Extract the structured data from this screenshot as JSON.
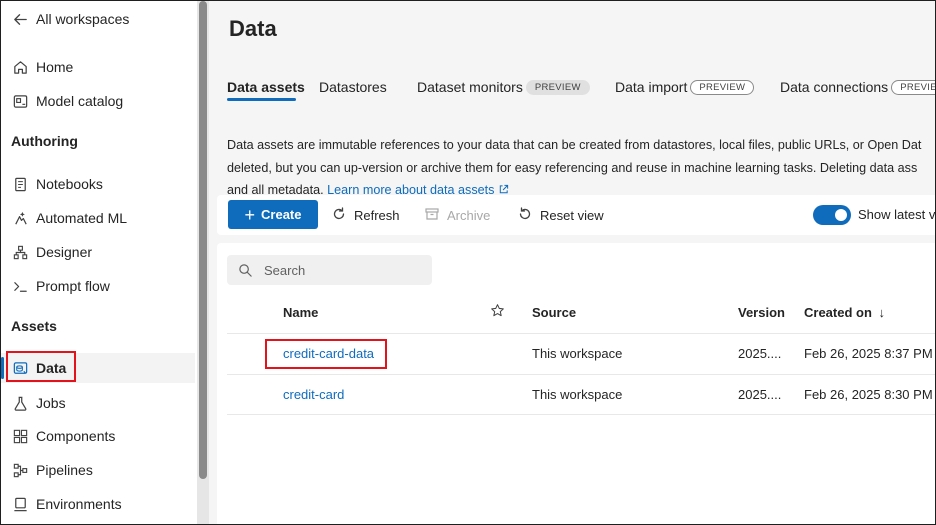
{
  "sidebar": {
    "back_label": "All workspaces",
    "items_top": [
      {
        "label": "Home",
        "icon": "home-icon"
      },
      {
        "label": "Model catalog",
        "icon": "catalog-icon"
      }
    ],
    "sections": [
      {
        "title": "Authoring",
        "items": [
          {
            "label": "Notebooks",
            "icon": "notebook-icon"
          },
          {
            "label": "Automated ML",
            "icon": "automl-icon"
          },
          {
            "label": "Designer",
            "icon": "designer-icon"
          },
          {
            "label": "Prompt flow",
            "icon": "prompt-icon"
          }
        ]
      },
      {
        "title": "Assets",
        "items": [
          {
            "label": "Data",
            "icon": "data-icon",
            "active": true
          },
          {
            "label": "Jobs",
            "icon": "flask-icon"
          },
          {
            "label": "Components",
            "icon": "components-icon"
          },
          {
            "label": "Pipelines",
            "icon": "pipeline-icon"
          },
          {
            "label": "Environments",
            "icon": "environment-icon"
          }
        ]
      }
    ]
  },
  "main": {
    "title": "Data",
    "tabs": [
      {
        "label": "Data assets",
        "active": true
      },
      {
        "label": "Datastores"
      },
      {
        "label": "Dataset monitors",
        "badge": "PREVIEW"
      },
      {
        "label": "Data import",
        "badge": "PREVIEW"
      },
      {
        "label": "Data connections",
        "badge": "PREVIEW"
      }
    ],
    "description": {
      "line1": "Data assets are immutable references to your data that can be created from datastores, local files, public URLs, or Open Dat",
      "line2": "deleted, but you can up-version or archive them for easy referencing and reuse in machine learning tasks. Deleting data ass",
      "line3": "and all metadata.",
      "link": "Learn more about data assets"
    },
    "toolbar": {
      "create": "Create",
      "refresh": "Refresh",
      "archive": "Archive",
      "reset": "Reset view",
      "show_latest": "Show latest ve"
    },
    "search": {
      "placeholder": "Search"
    },
    "table": {
      "columns": [
        "Name",
        "Source",
        "Version",
        "Created on"
      ],
      "sort_indicator": "↓",
      "rows": [
        {
          "name": "credit-card-data",
          "source": "This workspace",
          "version": "2025....",
          "created": "Feb 26, 2025 8:37 PM"
        },
        {
          "name": "credit-card",
          "source": "This workspace",
          "version": "2025....",
          "created": "Feb 26, 2025 8:30 PM"
        }
      ]
    }
  },
  "colors": {
    "accent": "#0f6cbd",
    "highlight": "#e3121b"
  }
}
